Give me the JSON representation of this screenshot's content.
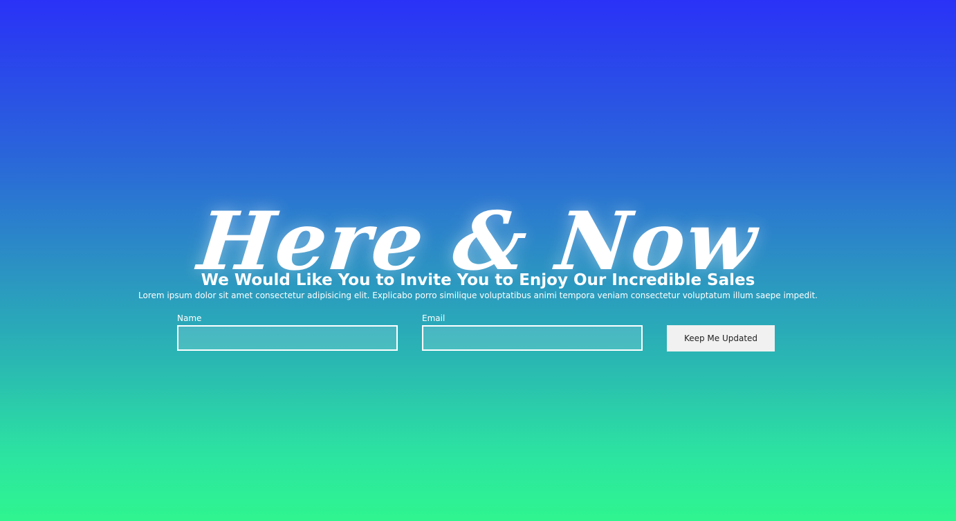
{
  "hero": {
    "brand": "Here & Now",
    "subtitle": "We Would Like You to Invite You to Enjoy Our Incredible Sales",
    "lede": "Lorem ipsum dolor sit amet consectetur adipisicing elit. Explicabo porro similique voluptatibus animi tempora veniam consectetur voluptatum illum saepe impedit."
  },
  "form": {
    "name_label": "Name",
    "name_value": "",
    "email_label": "Email",
    "email_value": "",
    "submit_label": "Keep Me Updated"
  },
  "colors": {
    "gradient_top": "#2a32f7",
    "gradient_bottom": "#2ff58f",
    "text": "#ffffff",
    "button_bg": "#f1f1f1"
  }
}
